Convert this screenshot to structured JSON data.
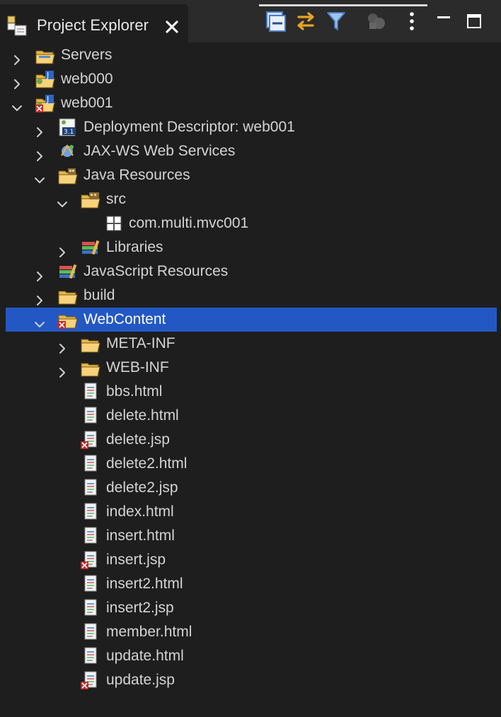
{
  "view": {
    "title": "Project Explorer"
  },
  "toolbar": {
    "icons": [
      "collapse-all-icon",
      "link-with-editor-icon",
      "filter-icon",
      "focus-on-working-set-icon",
      "view-menu-icon",
      "minimize-icon",
      "maximize-icon"
    ]
  },
  "tree": [
    {
      "label": "Servers",
      "level": 0,
      "expander": "collapsed",
      "icon": "server-folder-icon"
    },
    {
      "label": "web000",
      "level": 0,
      "expander": "collapsed",
      "icon": "web-project-icon"
    },
    {
      "label": "web001",
      "level": 0,
      "expander": "expanded",
      "icon": "web-project-error-icon"
    },
    {
      "label": "Deployment Descriptor: web001",
      "level": 1,
      "expander": "collapsed",
      "icon": "deployment-descriptor-icon"
    },
    {
      "label": "JAX-WS Web Services",
      "level": 1,
      "expander": "collapsed",
      "icon": "jaxws-icon"
    },
    {
      "label": "Java Resources",
      "level": 1,
      "expander": "expanded",
      "icon": "java-resources-icon"
    },
    {
      "label": "src",
      "level": 2,
      "expander": "expanded",
      "icon": "source-folder-icon"
    },
    {
      "label": "com.multi.mvc001",
      "level": 3,
      "expander": "none",
      "icon": "package-icon"
    },
    {
      "label": "Libraries",
      "level": 2,
      "expander": "collapsed",
      "icon": "libraries-icon"
    },
    {
      "label": "JavaScript Resources",
      "level": 1,
      "expander": "collapsed",
      "icon": "javascript-resources-icon"
    },
    {
      "label": "build",
      "level": 1,
      "expander": "collapsed",
      "icon": "folder-icon"
    },
    {
      "label": "WebContent",
      "level": 1,
      "expander": "expanded",
      "icon": "folder-error-icon",
      "selected": true
    },
    {
      "label": "META-INF",
      "level": 2,
      "expander": "collapsed",
      "icon": "folder-icon"
    },
    {
      "label": "WEB-INF",
      "level": 2,
      "expander": "collapsed",
      "icon": "folder-icon"
    },
    {
      "label": "bbs.html",
      "level": 2,
      "expander": "none",
      "icon": "html-file-icon"
    },
    {
      "label": "delete.html",
      "level": 2,
      "expander": "none",
      "icon": "html-file-icon"
    },
    {
      "label": "delete.jsp",
      "level": 2,
      "expander": "none",
      "icon": "jsp-file-error-icon"
    },
    {
      "label": "delete2.html",
      "level": 2,
      "expander": "none",
      "icon": "html-file-icon"
    },
    {
      "label": "delete2.jsp",
      "level": 2,
      "expander": "none",
      "icon": "jsp-file-icon"
    },
    {
      "label": "index.html",
      "level": 2,
      "expander": "none",
      "icon": "html-file-icon"
    },
    {
      "label": "insert.html",
      "level": 2,
      "expander": "none",
      "icon": "html-file-icon"
    },
    {
      "label": "insert.jsp",
      "level": 2,
      "expander": "none",
      "icon": "jsp-file-error-icon"
    },
    {
      "label": "insert2.html",
      "level": 2,
      "expander": "none",
      "icon": "html-file-icon"
    },
    {
      "label": "insert2.jsp",
      "level": 2,
      "expander": "none",
      "icon": "jsp-file-icon"
    },
    {
      "label": "member.html",
      "level": 2,
      "expander": "none",
      "icon": "html-file-icon"
    },
    {
      "label": "update.html",
      "level": 2,
      "expander": "none",
      "icon": "html-file-icon"
    },
    {
      "label": "update.jsp",
      "level": 2,
      "expander": "none",
      "icon": "jsp-file-error-icon"
    }
  ]
}
